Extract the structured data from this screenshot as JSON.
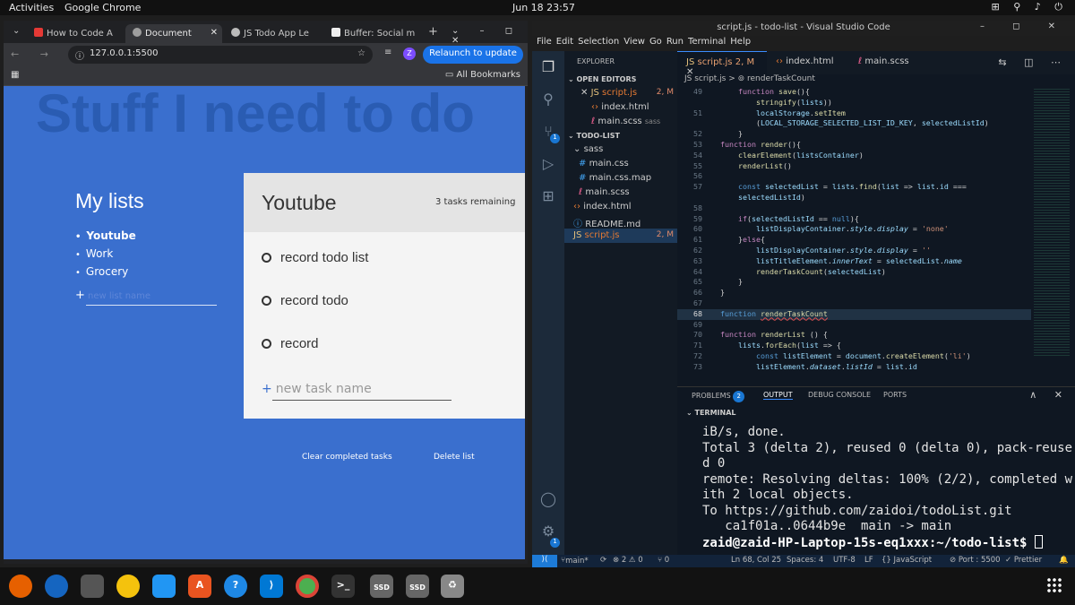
{
  "topbar": {
    "activities": "Activities",
    "app": "Google Chrome",
    "clock": "Jun 18  23:57",
    "tray": "⊞ ⚲ ♪ ⏻"
  },
  "chrome": {
    "tabs": [
      {
        "label": "How to Code A",
        "color": "#e53935"
      },
      {
        "label": "Document",
        "color": "#9e9e9e"
      },
      {
        "label": "JS Todo App Le",
        "color": "#bbbbbb"
      },
      {
        "label": "Buffer: Social m",
        "color": "#333333"
      }
    ],
    "new_tab": "+",
    "window_controls": "⌄ – ◻ ✕",
    "url": "127.0.0.1:5500",
    "avatar": "Z",
    "relaunch": "Relaunch to update",
    "bookmarks": "All Bookmarks"
  },
  "todo_app": {
    "big_title": "Stuff I need to do",
    "lists_title": "My lists",
    "lists": [
      {
        "label": "Youtube",
        "selected": true
      },
      {
        "label": "Work"
      },
      {
        "label": "Grocery"
      }
    ],
    "new_list_placeholder": "new list name",
    "add_symbol": "+",
    "selected_list": {
      "title": "Youtube",
      "remaining": "3 tasks remaining",
      "tasks": [
        "record todo list",
        "record todo",
        "record"
      ],
      "new_task_placeholder": "new task name"
    },
    "clear_completed": "Clear completed tasks",
    "delete_list": "Delete list"
  },
  "vscode": {
    "title": "script.js - todo-list - Visual Studio Code",
    "menu": [
      "File",
      "Edit",
      "Selection",
      "View",
      "Go",
      "Run",
      "Terminal",
      "Help"
    ],
    "explorer": {
      "header": "EXPLORER",
      "open_editors": "OPEN EDITORS",
      "open_files": [
        {
          "name": "script.js",
          "mark": "2, M"
        },
        {
          "name": "index.html",
          "mark": ""
        },
        {
          "name": "main.scss",
          "mark": "sass"
        }
      ],
      "folder": "TODO-LIST",
      "sass": "sass",
      "files": [
        {
          "name": "main.css"
        },
        {
          "name": "main.css.map"
        },
        {
          "name": "main.scss"
        },
        {
          "name": "index.html"
        },
        {
          "name": "README.md"
        },
        {
          "name": "script.js",
          "mark": "2, M"
        }
      ]
    },
    "tabs": [
      {
        "name": "script.js",
        "mark": "2, M"
      },
      {
        "name": "index.html"
      },
      {
        "name": "main.scss"
      }
    ],
    "breadcrumb": "JS script.js  >  ⊚ renderTaskCount",
    "panel": {
      "problems": "PROBLEMS",
      "problems_count": "2",
      "output": "OUTPUT",
      "debug": "DEBUG CONSOLE",
      "ports": "PORTS",
      "terminal": "TERMINAL",
      "lines": [
        "iB/s, done.",
        "Total 3 (delta 2), reused 0 (delta 0), pack-reuse",
        "d 0",
        "remote: Resolving deltas: 100% (2/2), completed w",
        "ith 2 local objects.",
        "To https://github.com/zaidoi/todoList.git",
        "   ca1f01a..0644b9e  main -> main"
      ],
      "prompt": "zaid@zaid-HP-Laptop-15s-eq1xxx:~/todo-list$ "
    },
    "status": {
      "branch": "main*",
      "sync": "⟳",
      "errors": "⊗ 2 ⚠ 0",
      "ports0": "⑂ 0",
      "pos": "Ln 68, Col 25",
      "spaces": "Spaces: 4",
      "enc": "UTF-8",
      "eol": "LF",
      "lang": "{} JavaScript",
      "port": "⊘ Port : 5500",
      "prettier": "✓ Prettier"
    }
  }
}
